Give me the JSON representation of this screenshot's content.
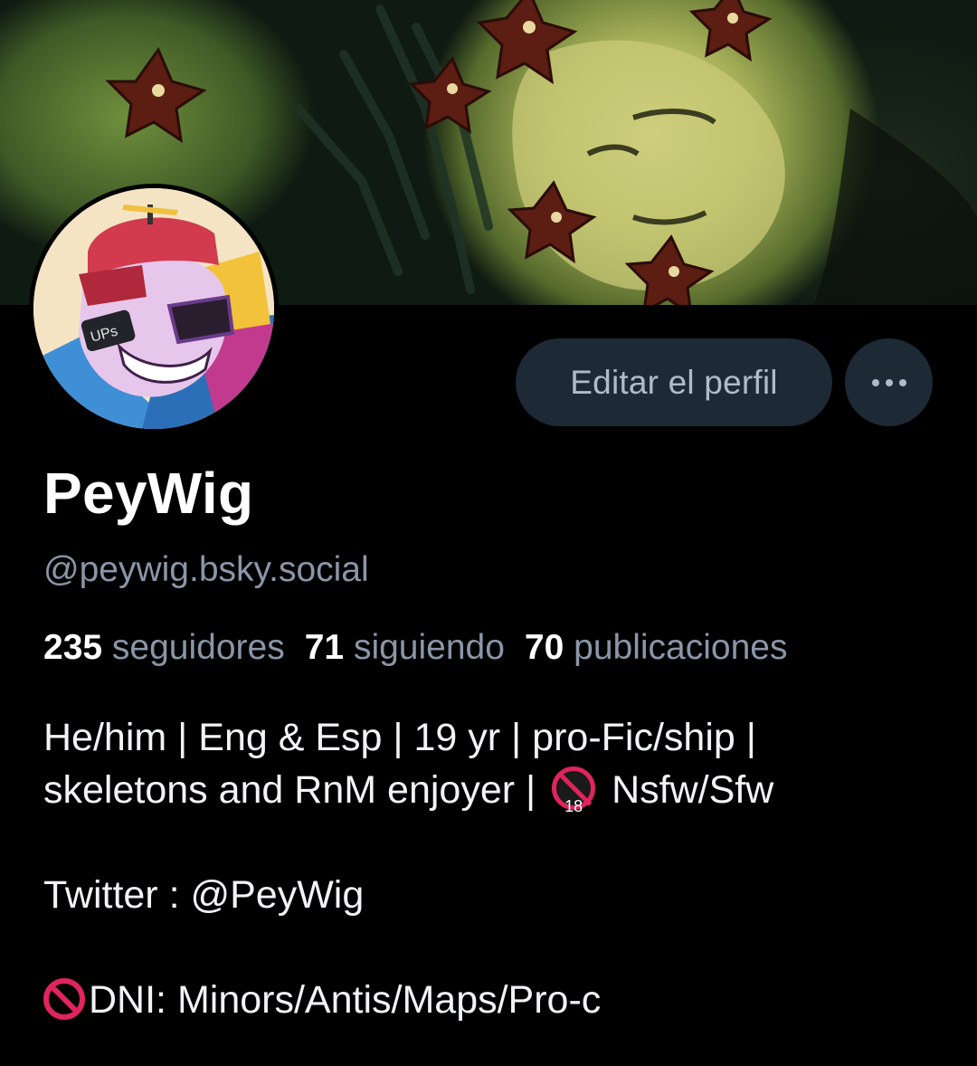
{
  "profile": {
    "display_name": "PeyWig",
    "handle": "@peywig.bsky.social",
    "banner_icon": "artwork-banner",
    "avatar_icon": "cartoon-skeleton-avatar",
    "avatar_badge_text": "UPs"
  },
  "actions": {
    "edit_label": "Editar el perfil",
    "more_icon": "ellipsis-icon"
  },
  "stats": {
    "followers_count": "235",
    "followers_label": "seguidores",
    "following_count": "71",
    "following_label": "siguiendo",
    "posts_count": "70",
    "posts_label": "publicaciones"
  },
  "bio": {
    "line1": "He/him | Eng & Esp | 19 yr | pro-Fic/ship |",
    "line2_text": "skeletons and RnM enjoyer |",
    "line2_icon": "under-18-prohibited-icon",
    "line2_icon_text": "18",
    "line2_suffix": "Nsfw/Sfw",
    "twitter": "Twitter : @PeyWig",
    "dni_icon": "no-entry-icon",
    "dni": "DNI: Minors/Antis/Maps/Pro-c"
  },
  "colors": {
    "background": "#000000",
    "button_bg": "#1e2936",
    "button_text": "#aebbcb",
    "muted_text": "#8a96a8",
    "warning_red": "#e0245e"
  }
}
